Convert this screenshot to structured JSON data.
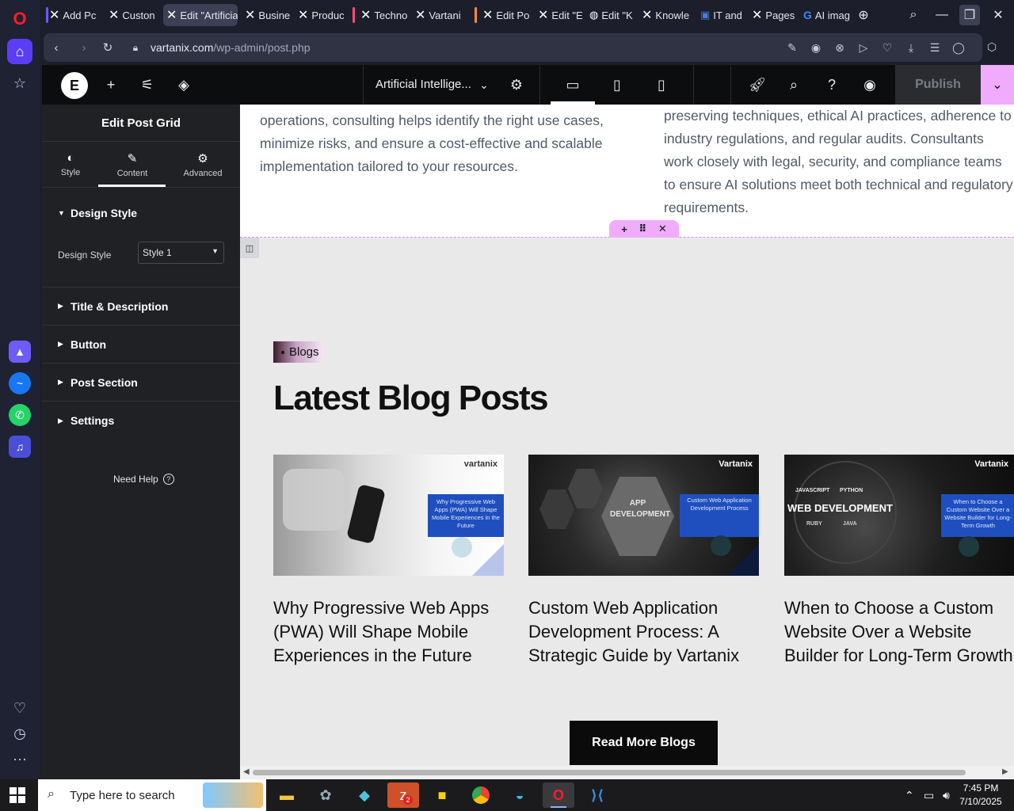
{
  "browser": {
    "tabs": [
      {
        "label": "Add Pc",
        "icon": "x"
      },
      {
        "label": "Custon",
        "icon": "x"
      },
      {
        "label": "Edit \"Artificia",
        "icon": "x",
        "active": true
      },
      {
        "label": "Busine",
        "icon": "x"
      },
      {
        "label": "Produc",
        "icon": "x"
      },
      {
        "label": "Techno",
        "icon": "x"
      },
      {
        "label": "Vartani",
        "icon": "x"
      },
      {
        "label": "Edit Po",
        "icon": "x"
      },
      {
        "label": "Edit \"E",
        "icon": "x"
      },
      {
        "label": "Edit \"K",
        "icon": "globe"
      },
      {
        "label": "Knowle",
        "icon": "x"
      },
      {
        "label": "IT and",
        "icon": "doc"
      },
      {
        "label": "Pages",
        "icon": "x"
      },
      {
        "label": "AI imag",
        "icon": "google"
      }
    ],
    "url_domain": "vartanix.com",
    "url_path": "/wp-admin/post.php"
  },
  "editor": {
    "document_title": "Artificial Intellige...",
    "publish_label": "Publish"
  },
  "panel": {
    "title": "Edit Post Grid",
    "tabs": [
      {
        "label": "Style",
        "icon": "◐"
      },
      {
        "label": "Content",
        "icon": "✎"
      },
      {
        "label": "Advanced",
        "icon": "⚙"
      }
    ],
    "sections": {
      "design_style": "Design Style",
      "title_desc": "Title & Description",
      "button": "Button",
      "post_section": "Post Section",
      "settings": "Settings"
    },
    "design_style_label": "Design Style",
    "design_style_value": "Style 1",
    "need_help": "Need Help"
  },
  "canvas": {
    "left_paragraph": "operations, consulting helps identify the right use cases, minimize risks, and ensure a cost-effective and scalable implementation tailored to your resources.",
    "right_paragraph": "preserving techniques, ethical AI practices, adherence to industry regulations, and regular audits. Consultants work closely with legal, security, and compliance teams to ensure AI solutions meet both technical and regulatory requirements.",
    "badge": "Blogs",
    "heading": "Latest Blog Posts",
    "cards": [
      {
        "title": "Why Progressive Web Apps (PWA) Will Shape Mobile Experiences in the Future",
        "image_caption": "Why Progressive Web Apps (PWA) Will Shape Mobile Experiences in the Future",
        "brand": "vartanix"
      },
      {
        "title": "Custom Web Application Development Process: A Strategic Guide by Vartanix",
        "image_caption": "Custom Web Application Development Process",
        "image_text": "APP DEVELOPMENT",
        "brand": "Vartanix"
      },
      {
        "title": "When to Choose a Custom Website Over a Website Builder for Long-Term Growth",
        "image_caption": "When to Choose a Custom Website Over a Website Builder for Long-Term Growth",
        "image_text": "WEB DEVELOPMENT",
        "image_labels": [
          "JAVASCRIPT",
          "PYTHON",
          "RUBY",
          "JAVA"
        ],
        "brand": "Vartanix"
      }
    ],
    "read_more": "Read More Blogs"
  },
  "taskbar": {
    "search_placeholder": "Type here to search",
    "time": "7:45 PM",
    "date": "7/10/2025",
    "zoom_badge": "2"
  },
  "colors": {
    "accent_pink": "#f0abfc",
    "opera_purple": "#5b3df5",
    "panel_bg": "#1f2124",
    "canvas_bg": "#e9e9ea"
  }
}
